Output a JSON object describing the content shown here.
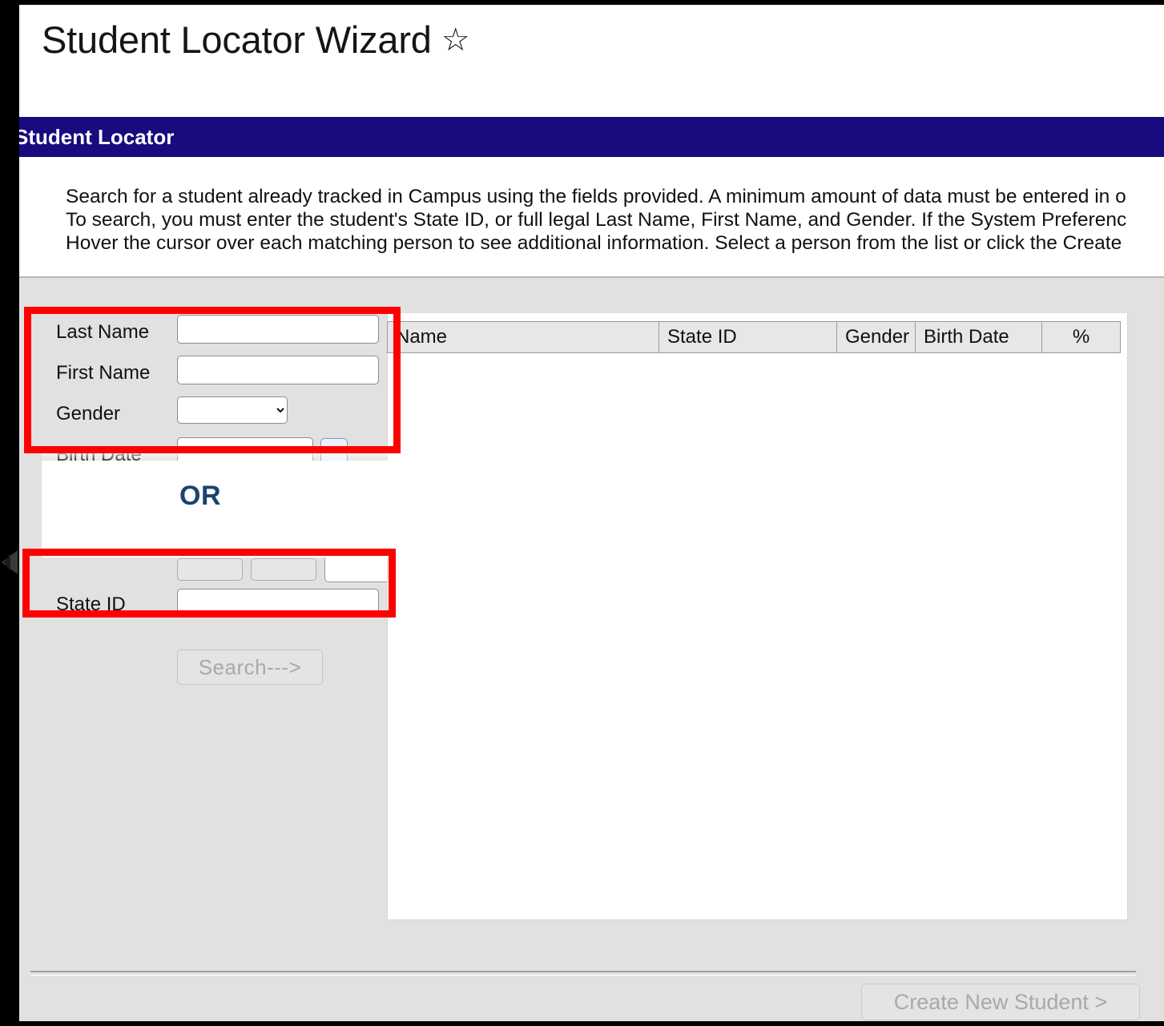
{
  "window": {
    "title": "Student Locator Wizard",
    "favorite_icon": "star-outline-icon"
  },
  "section": {
    "label": "Student Locator"
  },
  "instructions": {
    "lines": [
      "Search for a student already tracked in Campus using the fields provided. A minimum amount of data must be entered in o",
      "To search, you must enter the student's State ID, or full legal Last Name, First Name, and Gender. If the System Preferenc",
      "Hover the cursor over each matching person to see additional information. Select a person from the list or click the Create"
    ]
  },
  "form": {
    "fields": [
      {
        "label": "Last Name",
        "value": "",
        "placeholder": "",
        "type": "text"
      },
      {
        "label": "First Name",
        "value": "",
        "placeholder": "",
        "type": "text"
      },
      {
        "label": "Gender",
        "value": "",
        "placeholder": "",
        "type": "select"
      },
      {
        "label": "Birth Date",
        "value": "",
        "placeholder": "",
        "type": "date"
      },
      {
        "label": "State ID",
        "value": "",
        "placeholder": "",
        "type": "text"
      }
    ],
    "gender_options": [
      ""
    ],
    "or_divider_label": "OR",
    "search_button_label": "Search--->",
    "search_button_enabled": false
  },
  "results": {
    "columns": [
      "Name",
      "State ID",
      "Gender",
      "Birth Date",
      "%"
    ],
    "rows": []
  },
  "footer": {
    "create_student_label": "Create New Student >",
    "create_student_enabled": false
  },
  "annotations": {
    "highlight_color": "#fd0101",
    "or_label_color": "#1a4370",
    "section_bar_color": "#190a80",
    "boxes": [
      {
        "name": "name-gender-highlight"
      },
      {
        "name": "state-id-highlight"
      }
    ],
    "cursor_icon": "pointer-arrow-icon"
  }
}
